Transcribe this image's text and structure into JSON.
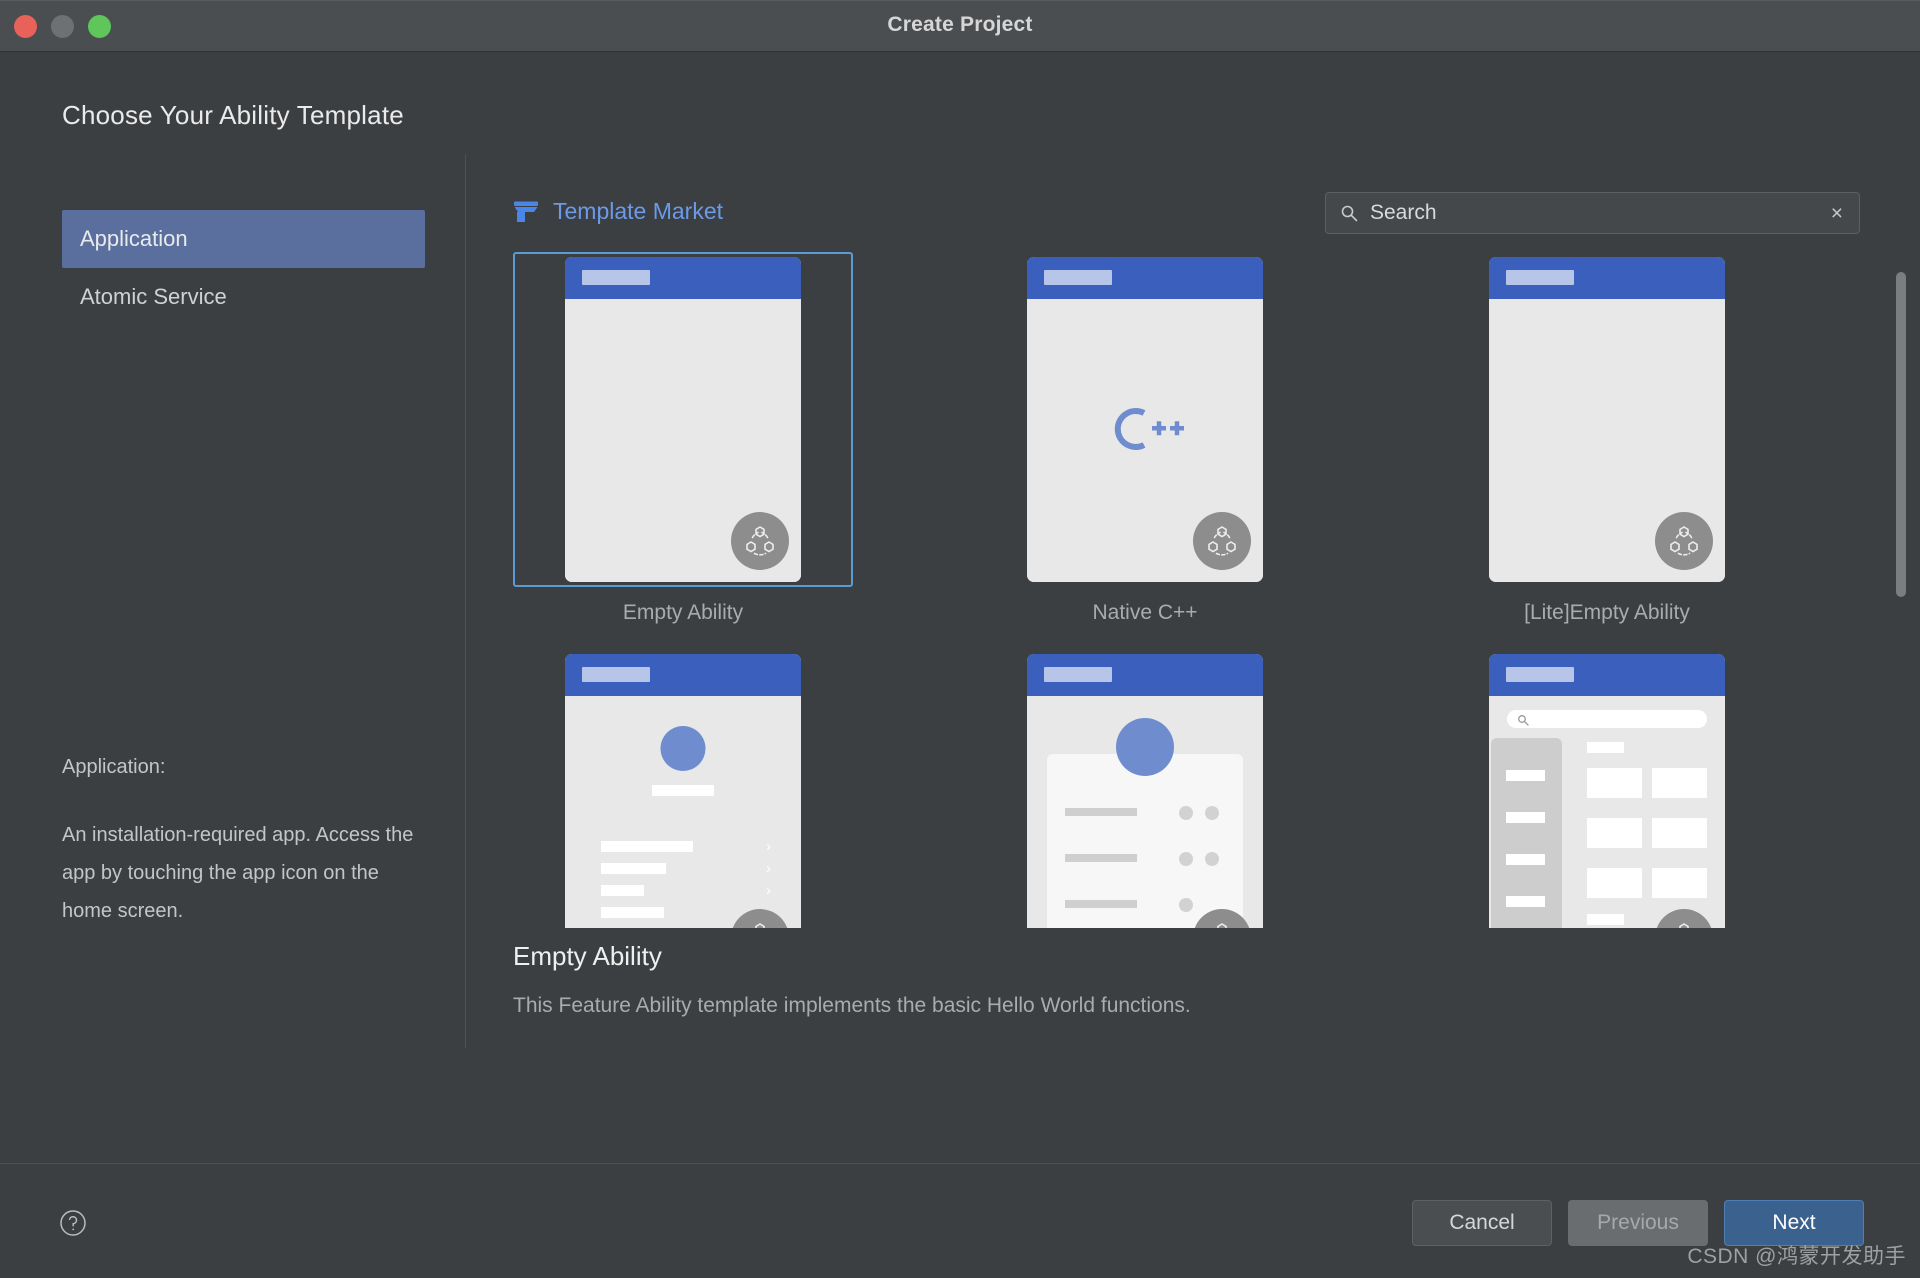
{
  "window": {
    "title": "Create Project",
    "traffic_lights": [
      "close",
      "minimize",
      "zoom"
    ]
  },
  "heading": "Choose Your Ability Template",
  "sidebar": {
    "items": [
      {
        "label": "Application",
        "selected": true
      },
      {
        "label": "Atomic Service",
        "selected": false
      }
    ],
    "description_label": "Application:",
    "description_text": "An installation-required app. Access the app by touching the app icon on the home screen."
  },
  "market": {
    "label": "Template Market",
    "icon": "shop-icon",
    "accent_color": "#6a9ae8"
  },
  "search": {
    "placeholder": "Search",
    "value": "",
    "clear_label": "×",
    "icon": "search-icon"
  },
  "templates": [
    {
      "name": "Empty Ability",
      "selected": true,
      "preview": "blank"
    },
    {
      "name": "Native C++",
      "selected": false,
      "preview": "cpp"
    },
    {
      "name": "[Lite]Empty Ability",
      "selected": false,
      "preview": "blank"
    },
    {
      "name": "",
      "selected": false,
      "preview": "profile-list"
    },
    {
      "name": "",
      "selected": false,
      "preview": "card-dots"
    },
    {
      "name": "",
      "selected": false,
      "preview": "catalog"
    }
  ],
  "detail": {
    "title": "Empty Ability",
    "description": "This Feature Ability template implements the basic Hello World functions."
  },
  "footer": {
    "help_icon": "help-icon",
    "buttons": [
      {
        "label": "Cancel",
        "style": "cancel"
      },
      {
        "label": "Previous",
        "style": "previous"
      },
      {
        "label": "Next",
        "style": "next"
      }
    ]
  },
  "watermark": "CSDN @鸿蒙开发助手",
  "colors": {
    "window_bg": "#3c3f41",
    "titlebar_bg": "#4b4e51",
    "selection_blue": "#5b6f9e",
    "card_blue": "#3a5fbd",
    "highlight_border": "#5b9bd5",
    "next_button": "#3b618f"
  }
}
